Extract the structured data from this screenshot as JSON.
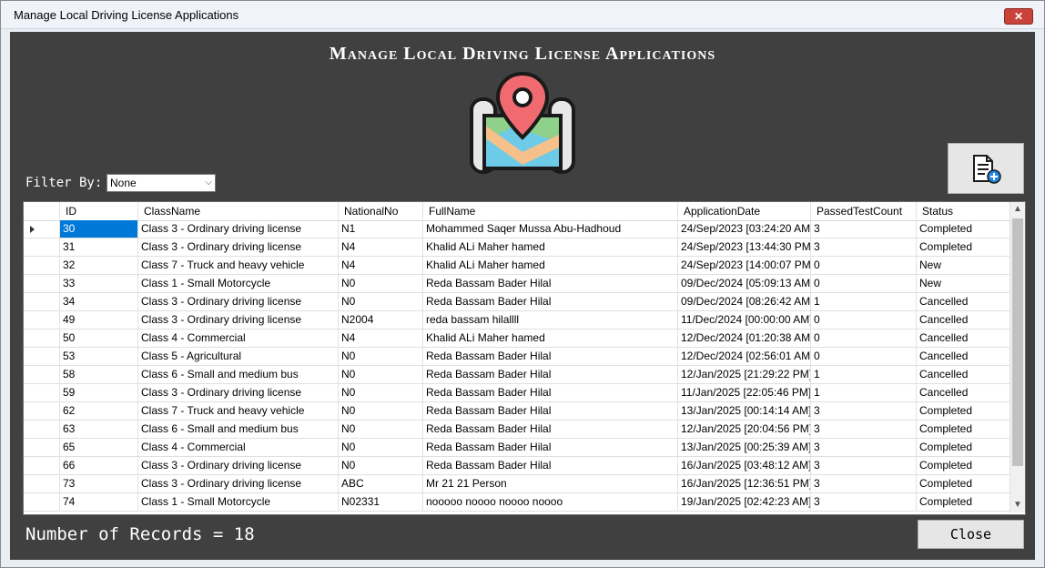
{
  "window": {
    "title": "Manage Local Driving License Applications",
    "close_glyph": "✕"
  },
  "heading": "Manage Local Driving License Applications",
  "logo_icon": "map-pin-icon",
  "filter": {
    "label": "Filter By:",
    "value": "None"
  },
  "add_button_icon": "add-document-icon",
  "columns": [
    "ID",
    "ClassName",
    "NationalNo",
    "FullName",
    "ApplicationDate",
    "PassedTestCount",
    "Status"
  ],
  "rows": [
    {
      "id": "30",
      "class": "Class 3 - Ordinary driving license",
      "national": "N1",
      "name": "Mohammed Saqer Mussa Abu-Hadhoud",
      "date": "24/Sep/2023 [03:24:20 AM]",
      "passed": "3",
      "status": "Completed"
    },
    {
      "id": "31",
      "class": "Class 3 - Ordinary driving license",
      "national": "N4",
      "name": "Khalid ALi Maher hamed",
      "date": "24/Sep/2023 [13:44:30 PM]",
      "passed": "3",
      "status": "Completed"
    },
    {
      "id": "32",
      "class": "Class 7 - Truck and heavy vehicle",
      "national": "N4",
      "name": "Khalid ALi Maher hamed",
      "date": "24/Sep/2023 [14:00:07 PM]",
      "passed": "0",
      "status": "New"
    },
    {
      "id": "33",
      "class": "Class 1 - Small Motorcycle",
      "national": "N0",
      "name": "Reda Bassam Bader Hilal",
      "date": "09/Dec/2024 [05:09:13 AM]",
      "passed": "0",
      "status": "New"
    },
    {
      "id": "34",
      "class": "Class 3 - Ordinary driving license",
      "national": "N0",
      "name": "Reda Bassam Bader Hilal",
      "date": "09/Dec/2024 [08:26:42 AM]",
      "passed": "1",
      "status": "Cancelled"
    },
    {
      "id": "49",
      "class": "Class 3 - Ordinary driving license",
      "national": "N2004",
      "name": "reda bassam  hilallll",
      "date": "11/Dec/2024 [00:00:00 AM]",
      "passed": "0",
      "status": "Cancelled"
    },
    {
      "id": "50",
      "class": "Class 4 - Commercial",
      "national": "N4",
      "name": "Khalid ALi Maher hamed",
      "date": "12/Dec/2024 [01:20:38 AM]",
      "passed": "0",
      "status": "Cancelled"
    },
    {
      "id": "53",
      "class": "Class 5 - Agricultural",
      "national": "N0",
      "name": "Reda Bassam Bader Hilal",
      "date": "12/Dec/2024 [02:56:01 AM]",
      "passed": "0",
      "status": "Cancelled"
    },
    {
      "id": "58",
      "class": "Class 6 - Small and medium bus",
      "national": "N0",
      "name": "Reda Bassam Bader Hilal",
      "date": "12/Jan/2025 [21:29:22 PM]",
      "passed": "1",
      "status": "Cancelled"
    },
    {
      "id": "59",
      "class": "Class 3 - Ordinary driving license",
      "national": "N0",
      "name": "Reda Bassam Bader Hilal",
      "date": "11/Jan/2025 [22:05:46 PM]",
      "passed": "1",
      "status": "Cancelled"
    },
    {
      "id": "62",
      "class": "Class 7 - Truck and heavy vehicle",
      "national": "N0",
      "name": "Reda Bassam Bader Hilal",
      "date": "13/Jan/2025 [00:14:14 AM]",
      "passed": "3",
      "status": "Completed"
    },
    {
      "id": "63",
      "class": "Class 6 - Small and medium bus",
      "national": "N0",
      "name": "Reda Bassam Bader Hilal",
      "date": "12/Jan/2025 [20:04:56 PM]",
      "passed": "3",
      "status": "Completed"
    },
    {
      "id": "65",
      "class": "Class 4 - Commercial",
      "national": "N0",
      "name": "Reda Bassam Bader Hilal",
      "date": "13/Jan/2025 [00:25:39 AM]",
      "passed": "3",
      "status": "Completed"
    },
    {
      "id": "66",
      "class": "Class 3 - Ordinary driving license",
      "national": "N0",
      "name": "Reda Bassam Bader Hilal",
      "date": "16/Jan/2025 [03:48:12 AM]",
      "passed": "3",
      "status": "Completed"
    },
    {
      "id": "73",
      "class": "Class 3 - Ordinary driving license",
      "national": "ABC",
      "name": "Mr 21 21 Person",
      "date": "16/Jan/2025 [12:36:51 PM]",
      "passed": "3",
      "status": "Completed"
    },
    {
      "id": "74",
      "class": "Class 1 - Small Motorcycle",
      "national": "N02331",
      "name": "nooooo noooo noooo noooo",
      "date": "19/Jan/2025 [02:42:23 AM]",
      "passed": "3",
      "status": "Completed"
    }
  ],
  "selected_row": 0,
  "records_label": "Number of Records = 18",
  "close_label": "Close",
  "colors": {
    "background": "#404040",
    "selection": "#0078d7"
  }
}
